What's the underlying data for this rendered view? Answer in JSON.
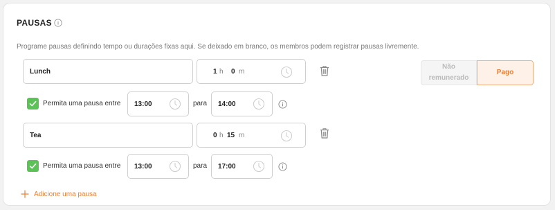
{
  "section": {
    "title": "PAUSAS",
    "description": "Programe pausas definindo tempo ou durações fixas aqui. Se deixado em branco, os membros podem registrar pausas livremente."
  },
  "breaks": [
    {
      "name": "Lunch",
      "hours": "1",
      "hours_unit": "h",
      "minutes": "0",
      "minutes_unit": "m",
      "allow_label": "Permita uma pausa entre",
      "start": "13:00",
      "to_label": "para",
      "end": "14:00",
      "checked": true
    },
    {
      "name": "Tea",
      "hours": "0",
      "hours_unit": "h",
      "minutes": "15",
      "minutes_unit": "m",
      "allow_label": "Permita uma pausa entre",
      "start": "13:00",
      "to_label": "para",
      "end": "17:00",
      "checked": true
    }
  ],
  "pay_toggle": {
    "unpaid_label": "Não remunerado",
    "paid_label": "Pago",
    "selected": "paid"
  },
  "add_break_label": "Adicione uma pausa",
  "colors": {
    "accent": "#ee7f33",
    "check": "#5cc157"
  }
}
